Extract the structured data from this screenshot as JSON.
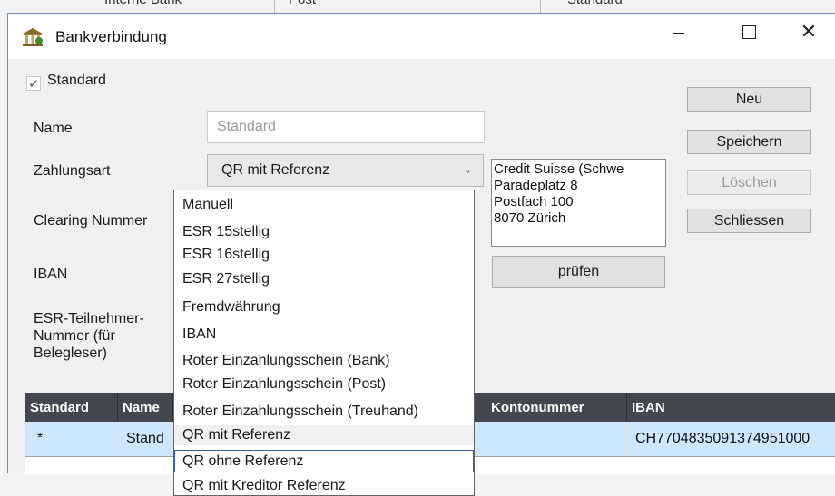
{
  "background": {
    "cells": [
      "Interne Bank",
      "Post",
      "Standard"
    ]
  },
  "window": {
    "title": "Bankverbindung"
  },
  "form": {
    "standard_checkbox": {
      "label": "Standard",
      "checked": true
    },
    "name_label": "Name",
    "name_placeholder": "Standard",
    "zahlungsart_label": "Zahlungsart",
    "zahlungsart_value": "QR mit Referenz",
    "clearing_label": "Clearing Nummer",
    "iban_label": "IBAN",
    "esr_label": "ESR-Teilnehmer-Nummer (für Belegleser)",
    "bank_address": [
      "Credit Suisse (Schwe",
      "Paradeplatz 8",
      "Postfach 100",
      "8070 Zürich"
    ],
    "pruefen_button": "prüfen"
  },
  "buttons": {
    "neu": "Neu",
    "speichern": "Speichern",
    "loeschen": "Löschen",
    "schliessen": "Schliessen"
  },
  "grid": {
    "headers": [
      "Standard",
      "Name",
      "",
      "Kontonummer",
      "IBAN"
    ],
    "rows": [
      [
        "*",
        "Stand",
        "",
        "",
        "CH7704835091374951000"
      ]
    ]
  },
  "dropdown": {
    "items": [
      "Manuell",
      "ESR 15stellig",
      "ESR 16stellig",
      "ESR 27stellig",
      "Fremdwährung",
      "IBAN",
      "Roter Einzahlungsschein (Bank)",
      "Roter Einzahlungsschein (Post)",
      "Roter Einzahlungsschein (Treuhand)",
      "QR mit Referenz",
      "QR ohne Referenz",
      "QR mit Kreditor Referenz"
    ],
    "selected_index": 9,
    "focused_index": 10
  }
}
